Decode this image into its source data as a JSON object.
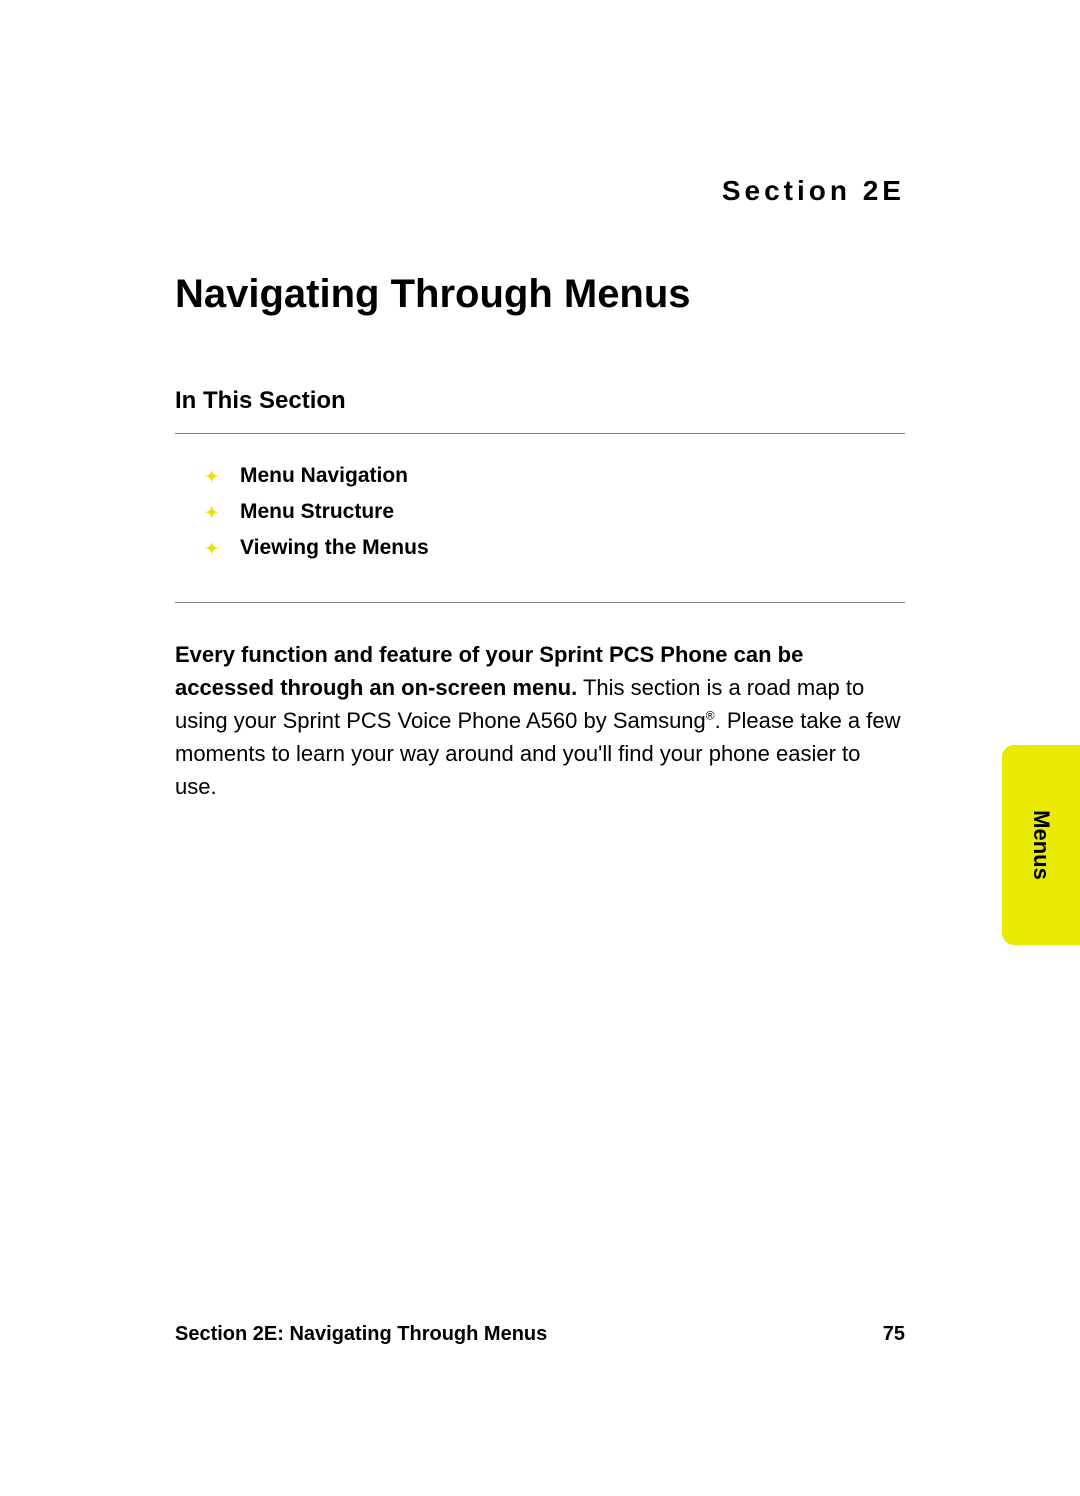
{
  "section_label": "Section 2E",
  "title": "Navigating Through Menus",
  "subtitle": "In This Section",
  "bullets": [
    "Menu Navigation",
    "Menu Structure",
    "Viewing the Menus"
  ],
  "body_bold": "Every function and feature of your Sprint PCS Phone can be accessed through an on-screen menu.",
  "body_rest_1": " This section is a road map to using your Sprint PCS Voice Phone A560 by Samsung",
  "body_rest_2": ". Please take a few moments to learn your way around and you'll find your phone easier to use.",
  "side_tab": "Menus",
  "footer_left": "Section 2E: Navigating Through Menus",
  "footer_right": "75",
  "reg_mark": "®"
}
